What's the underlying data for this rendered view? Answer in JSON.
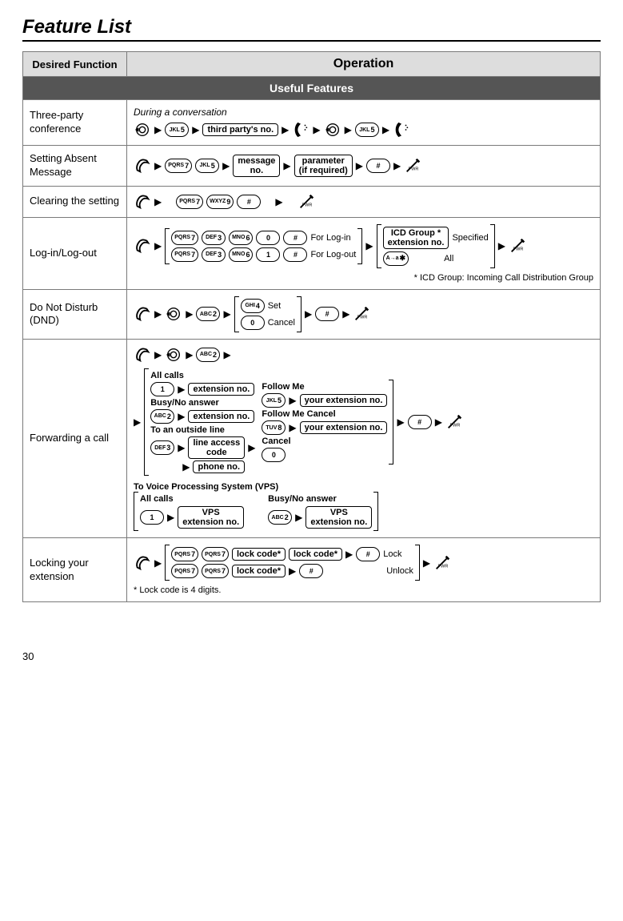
{
  "page_title": "Feature List",
  "page_number": "30",
  "header": {
    "desired_function": "Desired Function",
    "operation": "Operation"
  },
  "section_title": "Useful Features",
  "keys": {
    "k0": "0",
    "k1": "1",
    "k2": "2",
    "k3": "3",
    "k4": "4",
    "k5": "5",
    "k6": "6",
    "k7": "7",
    "k8": "8",
    "k9": "9",
    "s0": "",
    "s1": "",
    "s2": "ABC",
    "s3": "DEF",
    "s4": "GHI",
    "s5": "JKL",
    "s6": "MNO",
    "s7": "PQRS",
    "s8": "TUV",
    "s9": "WXYZ",
    "hash": "#",
    "star": "✱",
    "star_sub": "A→a"
  },
  "rows": {
    "three_party": {
      "fn": "Three-party conference",
      "note": "During a conversation",
      "third_party": "third party's no."
    },
    "absent": {
      "fn": "Setting Absent Message",
      "msg_no_l1": "message",
      "msg_no_l2": "no.",
      "param_l1": "parameter",
      "param_l2": "(if required)"
    },
    "clearing": {
      "fn": "Clearing the setting"
    },
    "loginout": {
      "fn": "Log-in/Log-out",
      "for_login": "For Log-in",
      "for_logout": "For Log-out",
      "icd_l1": "ICD Group *",
      "icd_l2": "extension no.",
      "specified": "Specified",
      "all": "All",
      "footnote": "*  ICD Group: Incoming Call Distribution Group"
    },
    "dnd": {
      "fn": "Do Not Disturb (DND)",
      "set": "Set",
      "cancel": "Cancel"
    },
    "fwd": {
      "fn": "Forwarding a call",
      "all_calls": "All calls",
      "busy_no": "Busy/No answer",
      "to_outside": "To an outside line",
      "ext_no": "extension no.",
      "line_access_l1": "line access",
      "line_access_l2": "code",
      "phone_no": "phone no.",
      "follow_me": "Follow Me",
      "follow_me_cancel": "Follow Me Cancel",
      "your_ext": "your extension no.",
      "cancel": "Cancel",
      "to_vps": "To Voice Processing System (VPS)",
      "vps_l1": "VPS",
      "vps_l2": "extension no."
    },
    "lock": {
      "fn": "Locking your extension",
      "lock_code": "lock code*",
      "lock": "Lock",
      "unlock": "Unlock",
      "footnote": "*  Lock code is 4 digits."
    }
  }
}
